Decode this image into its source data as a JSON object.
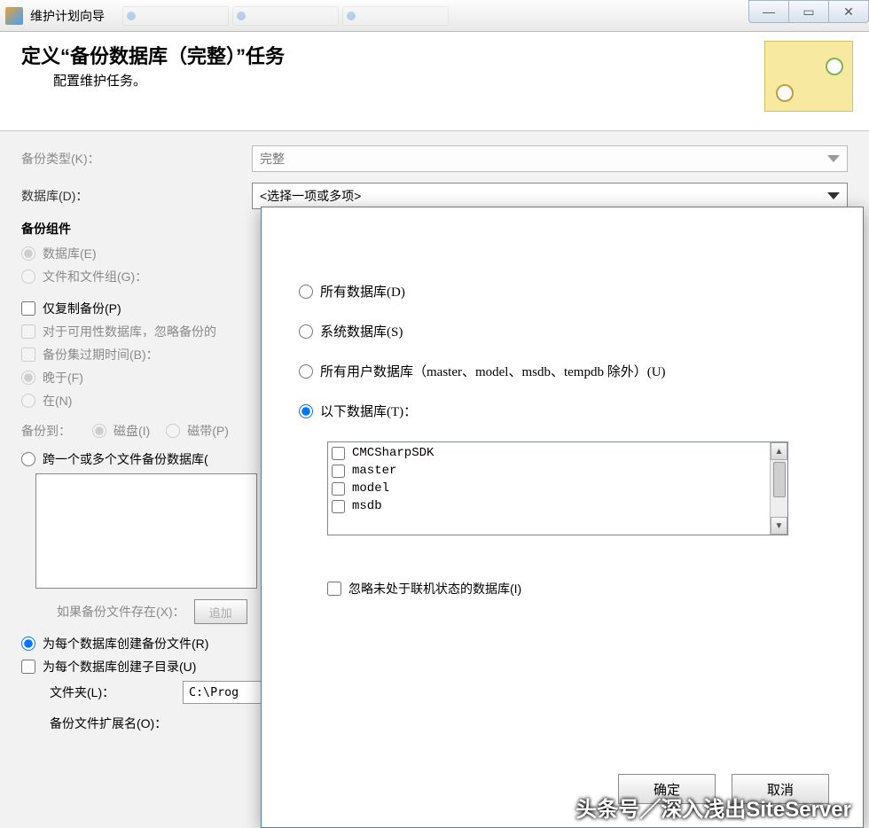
{
  "titlebar": {
    "title": "维护计划向导"
  },
  "header": {
    "title": "定义“备份数据库（完整）”任务",
    "subtitle": "配置维护任务。"
  },
  "form": {
    "backup_type_label": "备份类型(K)：",
    "backup_type_value": "完整",
    "database_label": "数据库(D)：",
    "database_value": "<选择一项或多项>",
    "components_head": "备份组件",
    "components_db": "数据库(E)",
    "components_files": "文件和文件组(G)：",
    "copy_only": "仅复制备份(P)",
    "availability": "对于可用性数据库，忽略备份的",
    "expire_label": "备份集过期时间(B)：",
    "expire_after": "晚于(F)",
    "expire_on": "在(N)",
    "backup_to": "备份到：",
    "disk": "磁盘(I)",
    "tape": "磁带(P)",
    "across_files": "跨一个或多个文件备份数据库(",
    "if_exists": "如果备份文件存在(X)：",
    "append": "追加",
    "create_per_db": "为每个数据库创建备份文件(R)",
    "create_subdir": "为每个数据库创建子目录(U)",
    "folder_label": "文件夹(L)：",
    "folder_value": "C:\\Prog",
    "ext_label": "备份文件扩展名(O)："
  },
  "popup": {
    "all_db": "所有数据库(D)",
    "system_db": "系统数据库(S)",
    "user_db": "所有用户数据库（master、model、msdb、tempdb 除外）(U)",
    "these_db": "以下数据库(T)：",
    "db_list": [
      "CMCSharpSDK",
      "master",
      "model",
      "msdb"
    ],
    "ignore_offline": "忽略未处于联机状态的数据库(I)",
    "ok": "确定",
    "cancel": "取消"
  },
  "watermark": "头条号／深入浅出SiteServer"
}
